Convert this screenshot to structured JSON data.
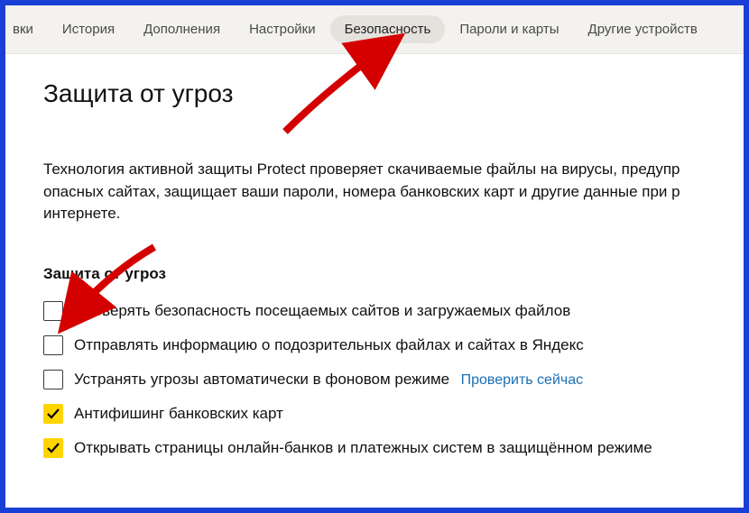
{
  "tabs": {
    "partial_left": "вки",
    "history": "История",
    "addons": "Дополнения",
    "settings": "Настройки",
    "security": "Безопасность",
    "passwords": "Пароли и карты",
    "devices": "Другие устройств"
  },
  "page": {
    "title": "Защита от угроз",
    "description": "Технология активной защиты Protect проверяет скачиваемые файлы на вирусы, предупр опасных сайтах, защищает ваши пароли, номера банковских карт и другие данные при р интернете."
  },
  "section": {
    "heading": "Защита от угроз",
    "options": [
      {
        "label": "Проверять безопасность посещаемых сайтов и загружаемых файлов",
        "checked": false
      },
      {
        "label": "Отправлять информацию о подозрительных файлах и сайтах в Яндекс",
        "checked": false
      },
      {
        "label": "Устранять угрозы автоматически в фоновом режиме",
        "checked": false,
        "link": "Проверить сейчас"
      },
      {
        "label": "Антифишинг банковских карт",
        "checked": true
      },
      {
        "label": "Открывать страницы онлайн-банков и платежных систем в защищённом режиме",
        "checked": true
      }
    ]
  }
}
